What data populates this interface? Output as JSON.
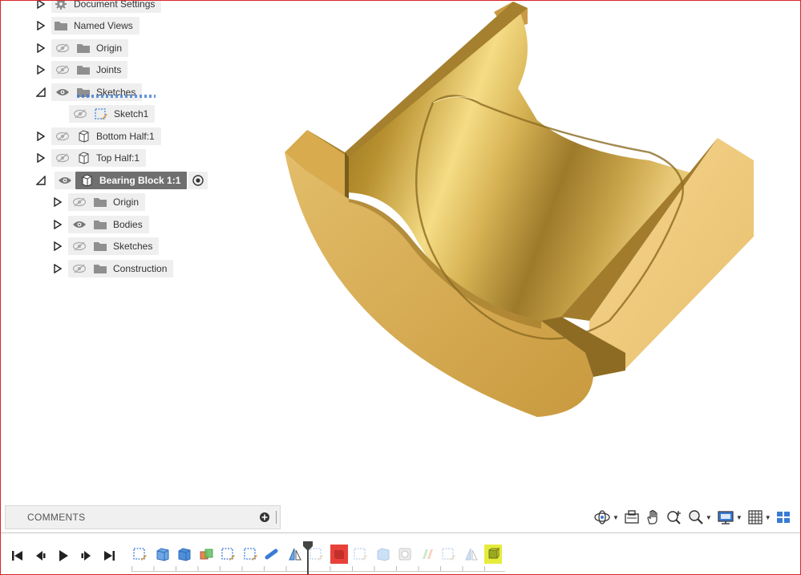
{
  "browser": {
    "items": [
      {
        "label": "Document Settings",
        "icon": "gear-icon",
        "expander": "collapsed",
        "visibility": null
      },
      {
        "label": "Named Views",
        "icon": "folder-icon",
        "expander": "collapsed",
        "visibility": null
      },
      {
        "label": "Origin",
        "icon": "folder-icon",
        "expander": "collapsed",
        "visibility": "hidden"
      },
      {
        "label": "Joints",
        "icon": "folder-icon",
        "expander": "collapsed",
        "visibility": "hidden"
      },
      {
        "label": "Sketches",
        "icon": "folder-icon",
        "expander": "expanded",
        "visibility": "visible"
      },
      {
        "label": "Sketch1",
        "icon": "sketch-icon",
        "expander": null,
        "visibility": "hidden"
      },
      {
        "label": "Bottom Half:1",
        "icon": "component-icon",
        "expander": "collapsed",
        "visibility": "hidden"
      },
      {
        "label": "Top Half:1",
        "icon": "component-icon",
        "expander": "collapsed",
        "visibility": "hidden"
      },
      {
        "label": "Bearing Block 1:1",
        "icon": "component-icon",
        "expander": "expanded",
        "visibility": "visible",
        "active": true
      },
      {
        "label": "Origin",
        "icon": "folder-icon",
        "expander": "collapsed",
        "visibility": "hidden"
      },
      {
        "label": "Bodies",
        "icon": "folder-icon",
        "expander": "collapsed",
        "visibility": "visible"
      },
      {
        "label": "Sketches",
        "icon": "folder-icon",
        "expander": "collapsed",
        "visibility": "hidden"
      },
      {
        "label": "Construction",
        "icon": "folder-icon",
        "expander": "collapsed",
        "visibility": "hidden"
      }
    ]
  },
  "comments": {
    "title": "COMMENTS"
  },
  "nav_toolbar": [
    "orbit-icon",
    "look-at-icon",
    "pan-icon",
    "zoom-window-icon",
    "zoom-icon",
    "display-settings-icon",
    "grid-icon",
    "viewports-icon"
  ],
  "timeline": {
    "playback": [
      "go-to-start-icon",
      "step-back-icon",
      "play-icon",
      "step-forward-icon",
      "go-to-end-icon"
    ],
    "features": [
      "sketch-icon",
      "extrude-icon",
      "extrude-icon",
      "combine-icon",
      "sketch-icon",
      "sketch-icon",
      "pipe-icon",
      "split-body-icon",
      "sketch-icon",
      "extrude-icon",
      "sketch-icon",
      "box-icon",
      "hole-icon",
      "combine-icon",
      "sketch-icon",
      "split-icon",
      "component-icon"
    ]
  },
  "colors": {
    "accent": "#3a7bd5",
    "active_row": "#6f6f6f",
    "row_bg": "#efefef",
    "brass": "#c9a23e",
    "marker_red": "#e8413a",
    "marker_yellow": "#e6ec3b"
  }
}
